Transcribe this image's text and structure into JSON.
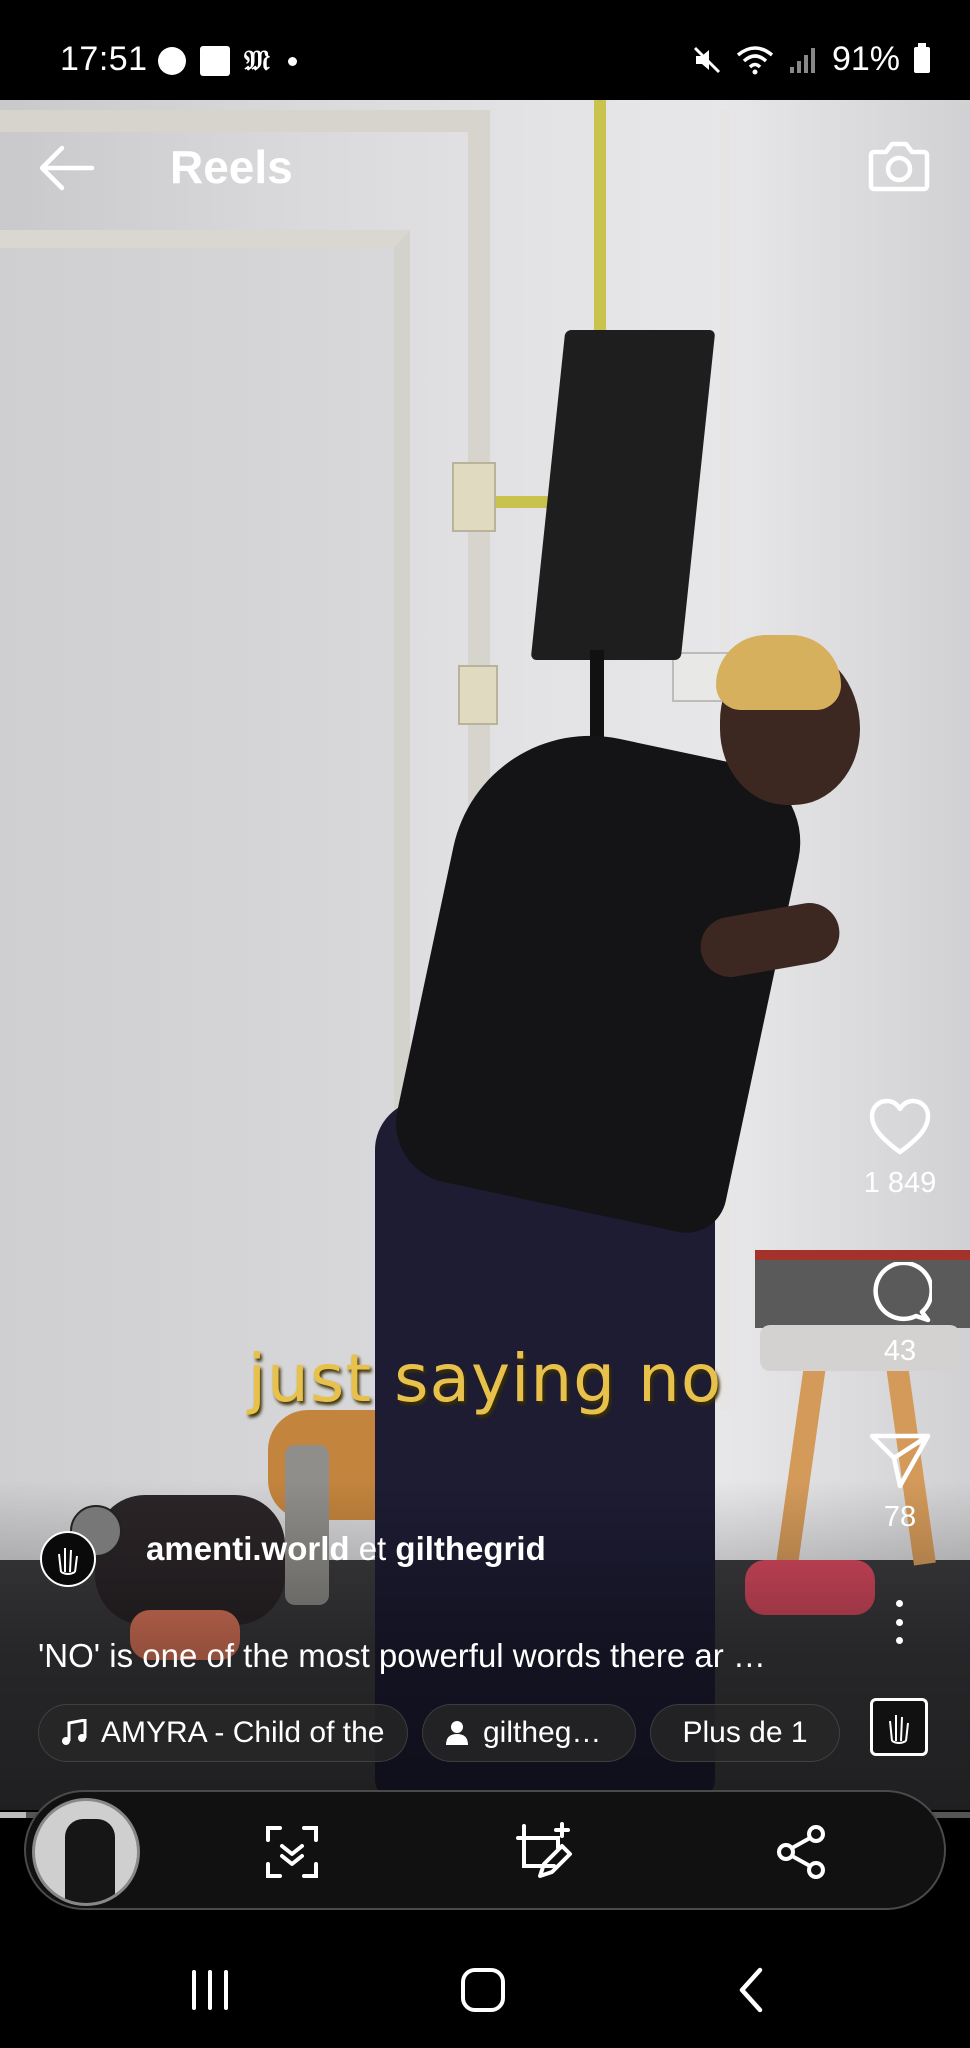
{
  "status_bar": {
    "time": "17:51",
    "battery": "91%",
    "icons": [
      "messenger-icon",
      "notes-icon",
      "gothic-m-icon",
      "dot-icon",
      "mute-icon",
      "wifi-icon",
      "signal-icon",
      "battery-icon"
    ]
  },
  "header": {
    "title": "Reels",
    "back_icon": "back-arrow-icon",
    "camera_icon": "camera-icon"
  },
  "video": {
    "caption_overlay": "just saying no"
  },
  "actions": {
    "like_count": "1 849",
    "comment_count": "43",
    "share_count": "78"
  },
  "post": {
    "author1": "amenti.world",
    "joiner": "et",
    "author2": "gilthegrid",
    "description": "'NO' is one of the most powerful words there ar …"
  },
  "chips": {
    "music": "AMYRA - Child of the",
    "user": "giltheg…",
    "more": "Plus de 1"
  },
  "toolbar": {
    "icons": [
      "scan-icon",
      "edit-crop-icon",
      "share-icon"
    ]
  },
  "nav": {
    "icons": [
      "recents-icon",
      "home-icon",
      "back-icon"
    ]
  },
  "colors": {
    "caption": "#e8c14d",
    "background": "#000000"
  }
}
